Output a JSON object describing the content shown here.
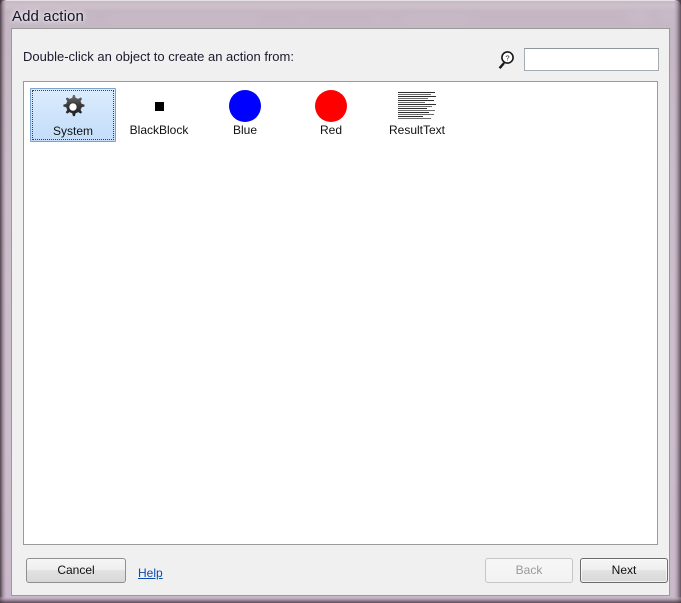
{
  "window": {
    "title": "Add action",
    "frame_color": "#ded0de",
    "client_bg": "#f0f0f0"
  },
  "dialog": {
    "instruction": "Double-click an object to create an action from:"
  },
  "search": {
    "icon": "magnifier-question-icon",
    "value": "",
    "placeholder": ""
  },
  "objects": [
    {
      "label": "System",
      "icon": "gear-icon",
      "selected": true,
      "color": "#4a4a4a"
    },
    {
      "label": "BlackBlock",
      "icon": "black-square-icon",
      "selected": false,
      "color": "#000000"
    },
    {
      "label": "Blue",
      "icon": "blue-circle-icon",
      "selected": false,
      "color": "#0000ff"
    },
    {
      "label": "Red",
      "icon": "red-circle-icon",
      "selected": false,
      "color": "#ff0000"
    },
    {
      "label": "ResultText",
      "icon": "text-document-icon",
      "selected": false,
      "color": "#2e2e2e"
    }
  ],
  "buttons": {
    "cancel": "Cancel",
    "help": "Help",
    "back": "Back",
    "next": "Next",
    "back_disabled": true,
    "next_default": true,
    "link_color": "#0b4ab0"
  }
}
